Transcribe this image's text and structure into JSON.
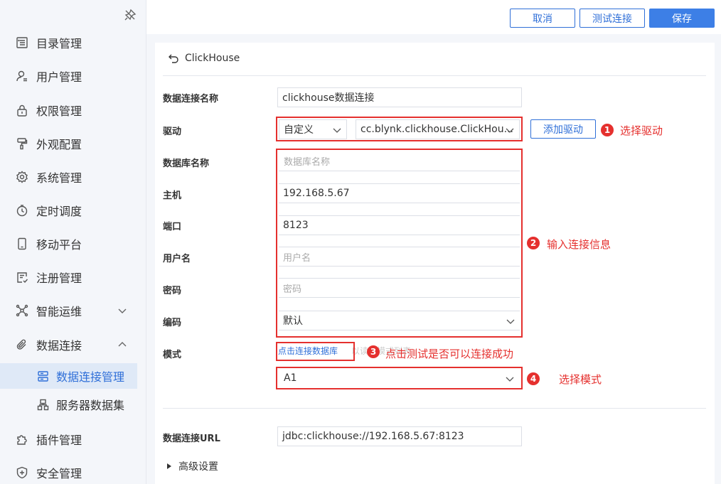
{
  "sidebar": {
    "pin_icon": "pin-icon",
    "items": [
      {
        "label": "目录管理",
        "icon": "catalog-icon"
      },
      {
        "label": "用户管理",
        "icon": "user-icon"
      },
      {
        "label": "权限管理",
        "icon": "lock-icon"
      },
      {
        "label": "外观配置",
        "icon": "paint-roller-icon"
      },
      {
        "label": "系统管理",
        "icon": "gear-icon"
      },
      {
        "label": "定时调度",
        "icon": "clock-icon"
      },
      {
        "label": "移动平台",
        "icon": "mobile-icon"
      },
      {
        "label": "注册管理",
        "icon": "register-icon"
      },
      {
        "label": "智能运维",
        "icon": "network-icon",
        "expand": "chevron-down-icon"
      },
      {
        "label": "数据连接",
        "icon": "paperclip-icon",
        "expand": "chevron-up-icon"
      },
      {
        "label": "插件管理",
        "icon": "puzzle-icon"
      },
      {
        "label": "安全管理",
        "icon": "shield-icon"
      }
    ],
    "sub_items": [
      {
        "label": "数据连接管理",
        "icon": "database-connection-icon",
        "active": true
      },
      {
        "label": "服务器数据集",
        "icon": "server-dataset-icon",
        "active": false
      }
    ]
  },
  "toolbar": {
    "cancel_label": "取消",
    "test_label": "测试连接",
    "save_label": "保存"
  },
  "form": {
    "back_label": "ClickHouse",
    "connection_name": {
      "label": "数据连接名称",
      "value": "clickhouse数据连接"
    },
    "driver": {
      "label": "驱动",
      "type_value": "自定义",
      "class_value": "cc.blynk.clickhouse.ClickHou...",
      "add_label": "添加驱动"
    },
    "db_name": {
      "label": "数据库名称",
      "placeholder": "数据库名称"
    },
    "host": {
      "label": "主机",
      "value": "192.168.5.67"
    },
    "port": {
      "label": "端口",
      "value": "8123"
    },
    "username": {
      "label": "用户名",
      "placeholder": "用户名"
    },
    "password": {
      "label": "密码",
      "placeholder": "密码"
    },
    "encoding": {
      "label": "编码",
      "value": "默认"
    },
    "schema": {
      "label": "模式",
      "link_label": "点击连接数据库",
      "hint": "以读取模式列表",
      "value": "A1"
    },
    "url": {
      "label": "数据连接URL",
      "value": "jdbc:clickhouse://192.168.5.67:8123"
    },
    "advanced_label": "高级设置"
  },
  "annotations": [
    {
      "num": "1",
      "text": "选择驱动"
    },
    {
      "num": "2",
      "text": "输入连接信息"
    },
    {
      "num": "3",
      "text": "点击测试是否可以连接成功"
    },
    {
      "num": "4",
      "text": "选择模式"
    }
  ],
  "colors": {
    "accent": "#2f6fd8",
    "primary_button": "#3d7fe6",
    "annotation_red": "#e5302e",
    "sidebar_bg": "#f4f6fa",
    "active_bg": "#dfe9f7"
  }
}
